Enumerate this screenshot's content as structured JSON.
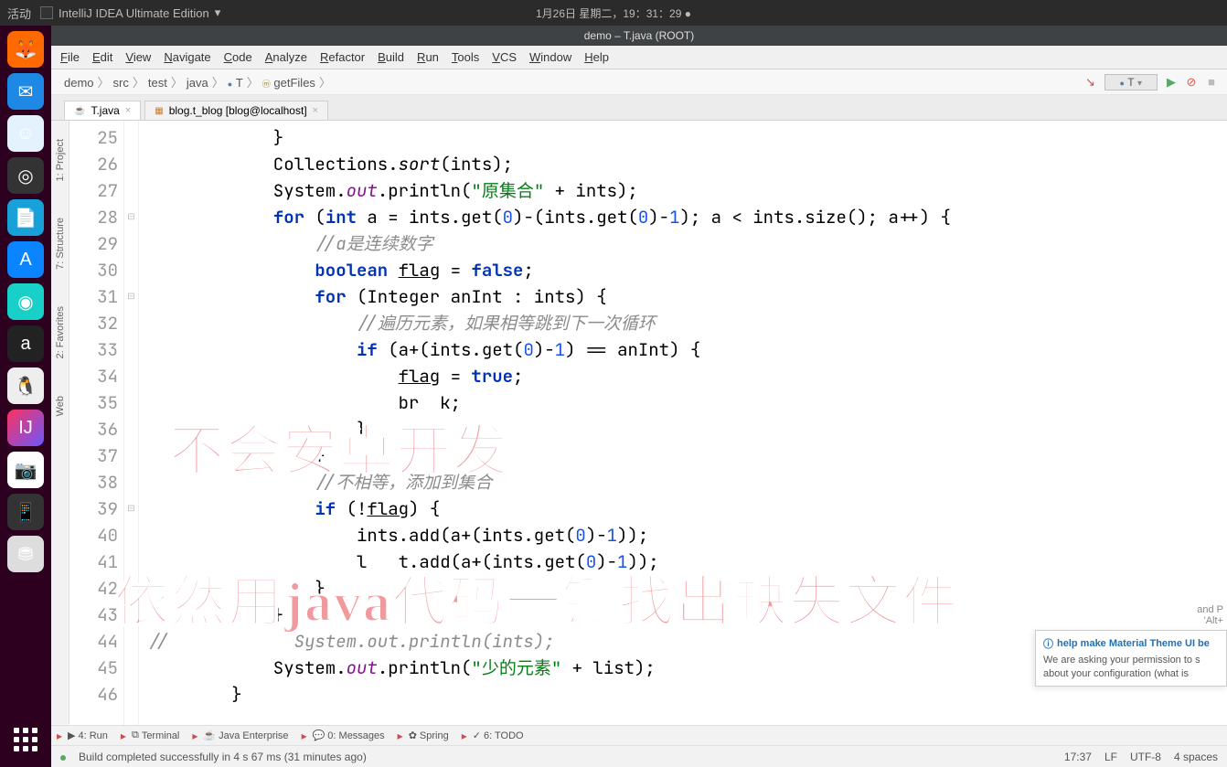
{
  "topbar": {
    "activity": "活动",
    "appname": "IntelliJ IDEA Ultimate Edition",
    "datetime": "1月26日 星期二，19：31：29 ●"
  },
  "window_title": "demo – T.java (ROOT)",
  "dock": [
    {
      "name": "firefox",
      "bg": "#ff6a00",
      "glyph": "🦊"
    },
    {
      "name": "thunderbird",
      "bg": "#1e88e5",
      "glyph": "✉"
    },
    {
      "name": "finder",
      "bg": "#e3f2fd",
      "glyph": "☺"
    },
    {
      "name": "rhythmbox",
      "bg": "#333",
      "glyph": "◎"
    },
    {
      "name": "libreoffice",
      "bg": "#18a0d8",
      "glyph": "📄"
    },
    {
      "name": "appstore",
      "bg": "#0a84ff",
      "glyph": "A"
    },
    {
      "name": "gnome",
      "bg": "#18d0c8",
      "glyph": "◉"
    },
    {
      "name": "amazon",
      "bg": "#222",
      "glyph": "a"
    },
    {
      "name": "qq",
      "bg": "#eee",
      "glyph": "🐧"
    },
    {
      "name": "intellij",
      "bg": "linear-gradient(135deg,#fe315d,#6b57ff)",
      "glyph": "IJ"
    },
    {
      "name": "screenshot",
      "bg": "#fff",
      "glyph": "📷"
    },
    {
      "name": "phone",
      "bg": "#333",
      "glyph": "📱"
    },
    {
      "name": "drive",
      "bg": "#ddd",
      "glyph": "⛃"
    }
  ],
  "menu": [
    "File",
    "Edit",
    "View",
    "Navigate",
    "Code",
    "Analyze",
    "Refactor",
    "Build",
    "Run",
    "Tools",
    "VCS",
    "Window",
    "Help"
  ],
  "breadcrumbs": [
    "demo",
    "src",
    "test",
    "java",
    "T",
    "getFiles"
  ],
  "run_config": "T",
  "tabs": [
    {
      "label": "T.java",
      "active": true,
      "icon": "j"
    },
    {
      "label": "blog.t_blog [blog@localhost]",
      "active": false,
      "icon": "tbl"
    }
  ],
  "side_tools": [
    "1: Project",
    "7: Structure",
    "2: Favorites",
    "Web"
  ],
  "line_numbers": [
    25,
    26,
    27,
    28,
    29,
    30,
    31,
    32,
    33,
    34,
    35,
    36,
    37,
    38,
    39,
    40,
    41,
    42,
    43,
    44,
    45,
    46
  ],
  "code_lines": [
    "            }",
    "            Collections.$isort$n(ints);",
    "            System.$fout$n.println($s\"原集合\"$n + ints);",
    "            $kfor$n ($kint$n a = ints.get($00$n)-(ints.get($00$n)-$01$n); a < ints.size(); a++) {",
    "                $c//a是连续数字$n",
    "                $kboolean$n $uflag$n = $kfalse$n;",
    "                $kfor$n (Integer anInt : ints) {",
    "                    $c//遍历元素，如果相等跳到下一次循环$n",
    "                    $kif$n (a+(ints.get($00$n)-$01$n) == anInt) {",
    "                        $uflag$n = $ktrue$n;",
    "                        br  k;",
    "                    }",
    "                }",
    "                $c//不相等，添加到集合$n",
    "                $kif$n (!$uflag$n) {",
    "                    ints.add(a+(ints.get($00$n)-$01$n));",
    "                    l   t.add(a+(ints.get($00$n)-$01$n));",
    "                }",
    "            }",
    "$c//            System.out.println(ints);$n",
    "            System.$fout$n.println($s\"少的元素\"$n + list);",
    "        }"
  ],
  "notification": {
    "title": "help make Material Theme UI be",
    "body": "We are asking your permission to s about your configuration (what is"
  },
  "hint_lines": [
    "and P",
    "'Alt+"
  ],
  "bottom_tools": [
    {
      "label": "4: Run",
      "icon": "▶"
    },
    {
      "label": "Terminal",
      "icon": "⧉"
    },
    {
      "label": "Java Enterprise",
      "icon": "☕"
    },
    {
      "label": "0: Messages",
      "icon": "💬"
    },
    {
      "label": "Spring",
      "icon": "✿"
    },
    {
      "label": "6: TODO",
      "icon": "✓"
    }
  ],
  "status": {
    "build": "Build completed successfully in 4 s 67 ms (31 minutes ago)",
    "pos": "17:37",
    "le": "LF",
    "enc": "UTF-8",
    "indent": "4 spaces"
  },
  "overlay": {
    "line1": "不会安卓开发",
    "line2": "依然用java代码一键找出缺失文件"
  }
}
